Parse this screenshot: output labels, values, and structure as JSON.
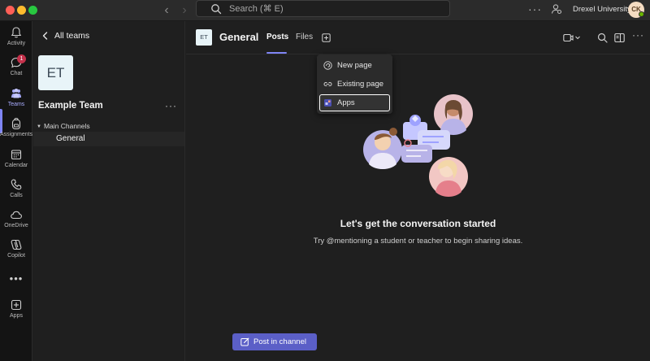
{
  "titlebar": {
    "search_placeholder": "Search (⌘ E)",
    "org_name": "Drexel University",
    "avatar_initials": "CK",
    "more": "···"
  },
  "rail": {
    "items": [
      {
        "label": "Activity",
        "icon": "bell-icon"
      },
      {
        "label": "Chat",
        "icon": "chat-icon",
        "badge": "1"
      },
      {
        "label": "Teams",
        "icon": "teams-icon",
        "active": true
      },
      {
        "label": "Assignments",
        "icon": "backpack-icon"
      },
      {
        "label": "Calendar",
        "icon": "calendar-icon"
      },
      {
        "label": "Calls",
        "icon": "phone-icon"
      },
      {
        "label": "OneDrive",
        "icon": "cloud-icon"
      },
      {
        "label": "Copilot",
        "icon": "copilot-icon"
      },
      {
        "label": "Apps",
        "icon": "apps-icon"
      }
    ],
    "more": "•••"
  },
  "teams_panel": {
    "back_label": "All teams",
    "team_initials": "ET",
    "team_name": "Example Team",
    "more": "···",
    "channels_header": "Main Channels",
    "channels": [
      "General"
    ]
  },
  "header": {
    "tile_initials": "ET",
    "channel_title": "General",
    "tabs": [
      {
        "label": "Posts",
        "active": true
      },
      {
        "label": "Files",
        "active": false
      }
    ],
    "more": "···"
  },
  "add_menu": {
    "items": [
      {
        "label": "New page",
        "icon": "loop-page-icon"
      },
      {
        "label": "Existing page",
        "icon": "link-icon"
      },
      {
        "label": "Apps",
        "icon": "apps-icon",
        "focused": true
      }
    ]
  },
  "empty_state": {
    "title": "Let's get the conversation started",
    "subtitle": "Try @mentioning a student or teacher to begin sharing ideas."
  },
  "compose": {
    "post_label": "Post in channel"
  },
  "colors": {
    "accent": "#5b5fc7",
    "accent_light": "#7f85f5",
    "badge": "#c4314b",
    "presence": "#6bb700"
  }
}
